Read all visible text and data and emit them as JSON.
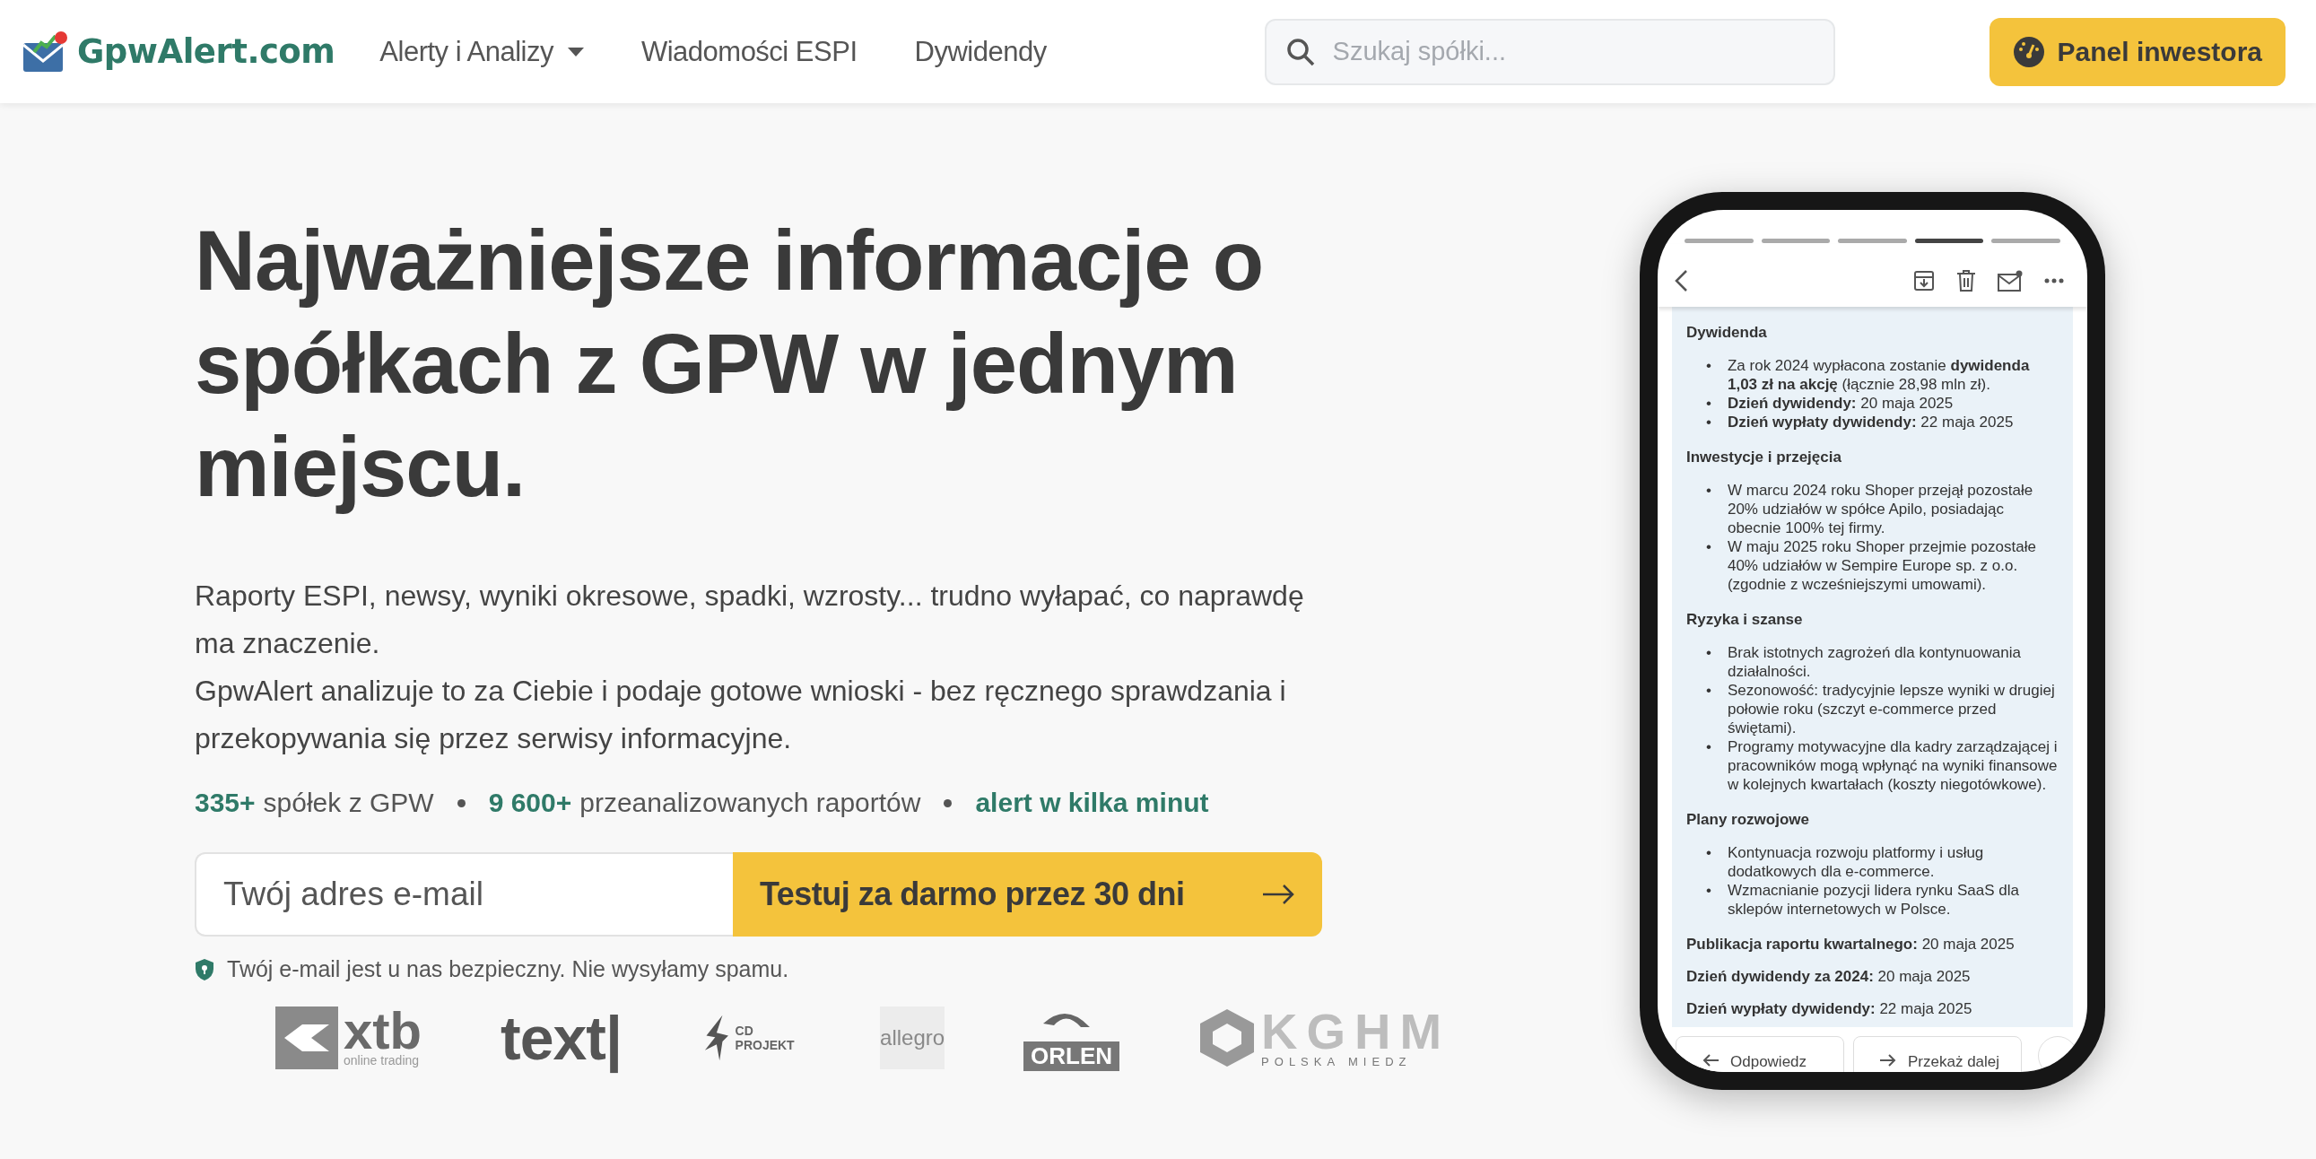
{
  "nav": {
    "brand": "GpwAlert.com",
    "links": [
      {
        "label": "Alerty i Analizy",
        "dropdown": true
      },
      {
        "label": "Wiadomości ESPI",
        "dropdown": false
      },
      {
        "label": "Dywidendy",
        "dropdown": false
      }
    ],
    "search": {
      "placeholder": "Szukaj spółki..."
    },
    "panel_button": "Panel inwestora"
  },
  "hero": {
    "title": "Najważniejsze informacje o spółkach z GPW w jednym miejscu.",
    "paragraphs": [
      "Raporty ESPI, newsy, wyniki okresowe, spadki, wzrosty... trudno wyłapać, co naprawdę ma znaczenie.",
      "GpwAlert analizuje to za Ciebie i podaje gotowe wnioski - bez ręcznego sprawdzania i przekopywania się przez serwisy informacyjne."
    ],
    "stats": [
      {
        "value": "335+",
        "label": "spółek z GPW"
      },
      {
        "value": "9 600+",
        "label": "przeanalizowanych raportów"
      },
      {
        "value": "alert w kilka minut"
      }
    ],
    "signup": {
      "placeholder": "Twój adres e-mail",
      "button": "Testuj za darmo przez 30 dni"
    },
    "privacy_note": "Twój e-mail jest u nas bezpieczny. Nie wysyłamy spamu.",
    "logos": [
      {
        "kind": "xtb",
        "text": "xtb",
        "tagline": "online trading"
      },
      {
        "kind": "text",
        "text": "text|"
      },
      {
        "kind": "cdprojekt",
        "text": "CD PROJEKT"
      },
      {
        "kind": "allegro",
        "text": "allegro"
      },
      {
        "kind": "orlen",
        "text": "ORLEN"
      },
      {
        "kind": "kghm",
        "text": "KGHM",
        "tagline": "POLSKA MIEDZ"
      }
    ]
  },
  "phone": {
    "bullet": "•",
    "progress": [
      {
        "selected": false
      },
      {
        "selected": false
      },
      {
        "selected": false
      },
      {
        "selected": true
      },
      {
        "selected": false
      }
    ],
    "sections": [
      {
        "heading": "Dywidenda",
        "items": [
          "Za rok 2024 wypłacona zostanie **dywidenda 1,03 zł na akcję** (łącznie 28,98 mln zł).",
          "**Dzień dywidendy:** 20 maja 2025",
          "**Dzień wypłaty dywidendy:** 22 maja 2025"
        ]
      },
      {
        "heading": "Inwestycje i przejęcia",
        "items": [
          "W marcu 2024 roku Shoper przejął pozostałe 20% udziałów w spółce Apilo, posiadając obecnie 100% tej firmy.",
          "W maju 2025 roku Shoper przejmie pozostałe 40% udziałów w Sempire Europe sp. z o.o. (zgodnie z wcześniejszymi umowami)."
        ]
      },
      {
        "heading": "Ryzyka i szanse",
        "items": [
          "Brak istotnych zagrożeń dla kontynuowania działalności.",
          "Sezonowość: tradycyjnie lepsze wyniki w drugiej połowie roku (szczyt e-commerce przed świętami).",
          "Programy motywacyjne dla kadry zarządzającej i pracowników mogą wpłynąć na wyniki finansowe w kolejnych kwartałach (koszty niegotówkowe)."
        ]
      },
      {
        "heading": "Plany rozwojowe",
        "items": [
          "Kontynuacja rozwoju platformy i usług dodatkowych dla e-commerce.",
          "Wzmacnianie pozycji lidera rynku SaaS dla sklepów internetowych w Polsce."
        ]
      }
    ],
    "summary": [
      "**Publikacja raportu kwartalnego:** 20 maja 2025",
      "**Dzień dywidendy za 2024:** 20 maja 2025",
      "**Dzień wypłaty dywidendy:** 22 maja 2025"
    ],
    "actions": [
      {
        "kind": "reply",
        "label": "Odpowiedz"
      },
      {
        "kind": "forward",
        "label": "Przekaż dalej"
      }
    ]
  }
}
